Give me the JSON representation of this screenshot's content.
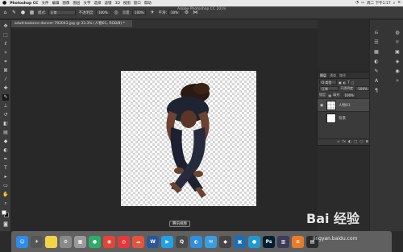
{
  "menubar": {
    "apple": "",
    "app_name": "Photoshop CC",
    "items": [
      "文件",
      "编辑",
      "图像",
      "图层",
      "文字",
      "选择",
      "滤镜",
      "3D",
      "视图",
      "窗口",
      "帮助"
    ],
    "clock": "周二 下午1:17"
  },
  "titlebar": {
    "title": "Adobe Photoshop CC 2019"
  },
  "options_bar": {
    "mode_label": "模式:",
    "mode_value": "正常",
    "opacity_label": "不透明度:",
    "opacity_value": "100%",
    "flow_label": "流量:",
    "flow_value": "100%",
    "smooth_label": "平滑:",
    "smooth_value": "10%"
  },
  "document_tab": {
    "label": "adult-balance-dancer-792043.jpg @ 33.3% (人物01, RGB/8) *"
  },
  "layers_panel": {
    "tabs": [
      "图层",
      "通道",
      "路径"
    ],
    "filter_label": "Q 类型",
    "blend_mode": "正常",
    "opacity_label": "不透明度:",
    "opacity_value": "100%",
    "lock_label": "锁定:",
    "fill_label": "填充:",
    "fill_value": "100%",
    "layers": [
      {
        "name": "人物01",
        "selected": true
      },
      {
        "name": "背景",
        "selected": false
      }
    ],
    "footer_icons": [
      "fx",
      "◐",
      "□",
      "▢",
      "⊞",
      "🗑"
    ]
  },
  "tooltip": {
    "text": "腾讯视频"
  },
  "dock": {
    "apps": [
      {
        "name": "finder-icon",
        "label": "☺",
        "color": "#2d8cf0"
      },
      {
        "name": "launchpad-icon",
        "label": "✈",
        "color": "#555"
      },
      {
        "name": "notes-icon",
        "label": "",
        "color": "#f3d34a"
      },
      {
        "name": "system-preferences-icon",
        "label": "⚙",
        "color": "#8a8a8a"
      },
      {
        "name": "preview-icon",
        "label": "▦",
        "color": "#9a9a9a"
      },
      {
        "name": "wechat-icon",
        "label": "●",
        "color": "#2aae67"
      },
      {
        "name": "chrome-icon",
        "label": "◉",
        "color": "#e94235"
      },
      {
        "name": "netease-music-icon",
        "label": "◎",
        "color": "#e6383b"
      },
      {
        "name": "baidu-netdisk-icon",
        "label": "☁",
        "color": "#e5533d"
      },
      {
        "name": "word-icon",
        "label": "W",
        "color": "#2b579a"
      },
      {
        "name": "tencent-video-icon",
        "label": "▶",
        "color": "#1fa2e8"
      },
      {
        "name": "quicktime-icon",
        "label": "Q",
        "color": "#4a4a4a"
      },
      {
        "name": "safari-icon",
        "label": "◐",
        "color": "#2f8ee0"
      },
      {
        "name": "mail-icon",
        "label": "✉",
        "color": "#3a9de0"
      },
      {
        "name": "app-icon-1",
        "label": "◆",
        "color": "#444"
      },
      {
        "name": "app-icon-2",
        "label": "▣",
        "color": "#1a6fb5"
      },
      {
        "name": "app-icon-3",
        "label": "●",
        "color": "#1d9ad6"
      },
      {
        "name": "photoshop-icon",
        "label": "Ps",
        "color": "#001e36"
      },
      {
        "name": "app-icon-4",
        "label": "▥",
        "color": "#3b3b5a"
      },
      {
        "name": "app-icon-5",
        "label": "≡",
        "color": "#e87b2a"
      },
      {
        "name": "app-icon-6",
        "label": "▤",
        "color": "#2c2c2c"
      }
    ]
  },
  "watermark": {
    "text": "Bai 经验",
    "url": "jingyan.baidu.com"
  }
}
